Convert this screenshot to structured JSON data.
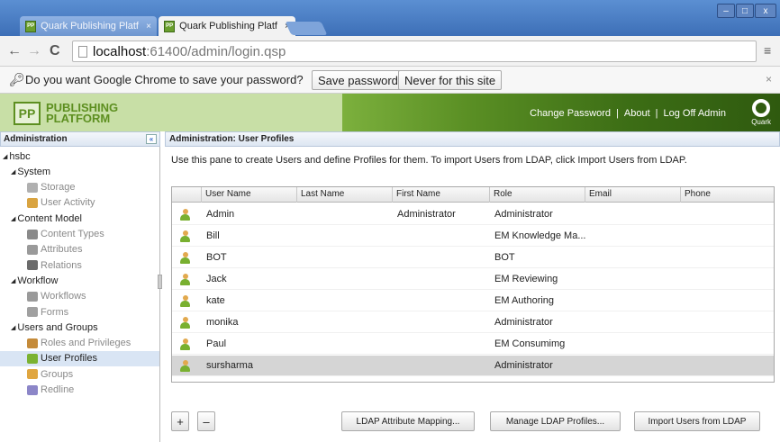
{
  "browser": {
    "tabs": [
      {
        "title": "Quark Publishing Platform",
        "close": "×"
      },
      {
        "title": "Quark Publishing Platform",
        "close": "×"
      }
    ],
    "window_controls": {
      "minimize": "–",
      "maximize": "□",
      "close": "x"
    },
    "url": {
      "host": "localhost",
      "path": ":61400/admin/login.qsp"
    },
    "password_bar": {
      "message": "Do you want Google Chrome to save your password?",
      "save_label": "Save password",
      "never_label": "Never for this site",
      "close": "×"
    }
  },
  "app": {
    "logo_badge": "PP",
    "logo_line1": "PUBLISHING",
    "logo_line2": "PLATFORM",
    "links": {
      "change_password": "Change Password",
      "about": "About",
      "logoff": "Log Off Admin",
      "sep": "|"
    },
    "quark_label": "Quark"
  },
  "left": {
    "header": "Administration",
    "collapse": "«",
    "tree": [
      {
        "label": "hsbc",
        "level": 0,
        "expander": "◢"
      },
      {
        "label": "System",
        "level": 1,
        "expander": "◢"
      },
      {
        "label": "Storage",
        "level": 2,
        "icon": "storage-icon",
        "gray": true
      },
      {
        "label": "User Activity",
        "level": 2,
        "icon": "user-activity-icon",
        "gray": true
      },
      {
        "label": "Content Model",
        "level": 1,
        "expander": "◢"
      },
      {
        "label": "Content Types",
        "level": 2,
        "icon": "content-types-icon",
        "gray": true
      },
      {
        "label": "Attributes",
        "level": 2,
        "icon": "attributes-icon",
        "gray": true
      },
      {
        "label": "Relations",
        "level": 2,
        "icon": "relations-icon",
        "gray": true
      },
      {
        "label": "Workflow",
        "level": 1,
        "expander": "◢"
      },
      {
        "label": "Workflows",
        "level": 2,
        "icon": "workflows-icon",
        "gray": true
      },
      {
        "label": "Forms",
        "level": 2,
        "icon": "forms-icon",
        "gray": true
      },
      {
        "label": "Users and Groups",
        "level": 1,
        "expander": "◢"
      },
      {
        "label": "Roles and Privileges",
        "level": 2,
        "icon": "roles-icon",
        "gray": true
      },
      {
        "label": "User Profiles",
        "level": 2,
        "icon": "user-profiles-icon",
        "selected": true
      },
      {
        "label": "Groups",
        "level": 2,
        "icon": "groups-icon",
        "gray": true
      },
      {
        "label": "Redline",
        "level": 2,
        "icon": "redline-icon",
        "gray": true
      }
    ]
  },
  "main": {
    "header": "Administration: User Profiles",
    "intro": "Use this pane to create Users and define Profiles for them. To import Users from LDAP, click Import Users from LDAP.",
    "columns": [
      "User Name",
      "Last Name",
      "First Name",
      "Role",
      "Email",
      "Phone"
    ],
    "rows": [
      {
        "user": "Admin",
        "last": "",
        "first": "Administrator",
        "role": "Administrator",
        "email": "",
        "phone": ""
      },
      {
        "user": "Bill",
        "last": "",
        "first": "",
        "role": "EM Knowledge Ma...",
        "email": "",
        "phone": ""
      },
      {
        "user": "BOT",
        "last": "",
        "first": "",
        "role": "BOT",
        "email": "",
        "phone": ""
      },
      {
        "user": "Jack",
        "last": "",
        "first": "",
        "role": "EM Reviewing",
        "email": "",
        "phone": ""
      },
      {
        "user": "kate",
        "last": "",
        "first": "",
        "role": "EM Authoring",
        "email": "",
        "phone": ""
      },
      {
        "user": "monika",
        "last": "",
        "first": "",
        "role": "Administrator",
        "email": "",
        "phone": ""
      },
      {
        "user": "Paul",
        "last": "",
        "first": "",
        "role": "EM Consumimg",
        "email": "",
        "phone": ""
      },
      {
        "user": "sursharma",
        "last": "",
        "first": "",
        "role": "Administrator",
        "email": "",
        "phone": "",
        "selected": true
      }
    ],
    "buttons": {
      "add": "+",
      "remove": "–",
      "ldap_mapping": "LDAP Attribute Mapping...",
      "manage_ldap": "Manage LDAP Profiles...",
      "import_ldap": "Import Users from LDAP"
    }
  }
}
